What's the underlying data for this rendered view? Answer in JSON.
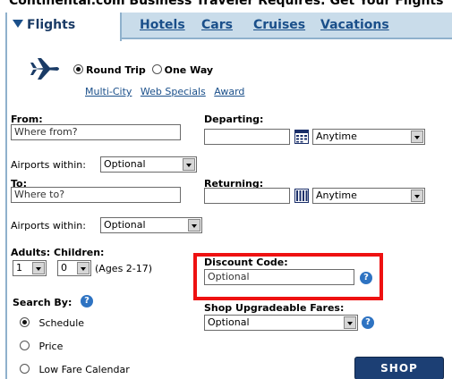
{
  "page_header": {
    "text": "Continental.com Business Traveler Requires: Get Your Flights"
  },
  "tabs": [
    {
      "label": "Flights",
      "active": true
    },
    {
      "label": "Hotels"
    },
    {
      "label": "Cars"
    },
    {
      "label": "Cruises"
    },
    {
      "label": "Vacations"
    }
  ],
  "trip_type": {
    "round_trip": "Round Trip",
    "one_way": "One Way",
    "selected": "Round Trip"
  },
  "links": {
    "multi_city": "Multi-City",
    "web_specials": "Web Specials",
    "award": "Award"
  },
  "from": {
    "label": "From:",
    "placeholder": "Where from?"
  },
  "departing": {
    "label": "Departing:",
    "time": "Anytime"
  },
  "airports_within_1": {
    "label": "Airports within:",
    "value": "Optional"
  },
  "to": {
    "label": "To:",
    "placeholder": "Where to?"
  },
  "returning": {
    "label": "Returning:",
    "time": "Anytime"
  },
  "airports_within_2": {
    "label": "Airports within:",
    "value": "Optional"
  },
  "passengers": {
    "label": "Adults: Children:",
    "adults": "1",
    "children": "0",
    "ages": "(Ages 2-17)"
  },
  "discount": {
    "label": "Discount Code:",
    "placeholder": "Optional"
  },
  "search_by": {
    "label": "Search By:",
    "options": [
      "Schedule",
      "Price",
      "Low Fare Calendar"
    ],
    "selected": "Schedule"
  },
  "upgradeable": {
    "label": "Shop Upgradeable Fares:",
    "value": "Optional"
  },
  "shop_button": {
    "label": "SHOP"
  },
  "colors": {
    "tab_bg": "#c9dcea",
    "link": "#1a4f8a",
    "highlight": "#ee1111",
    "shop_bg": "#1c3f74"
  }
}
